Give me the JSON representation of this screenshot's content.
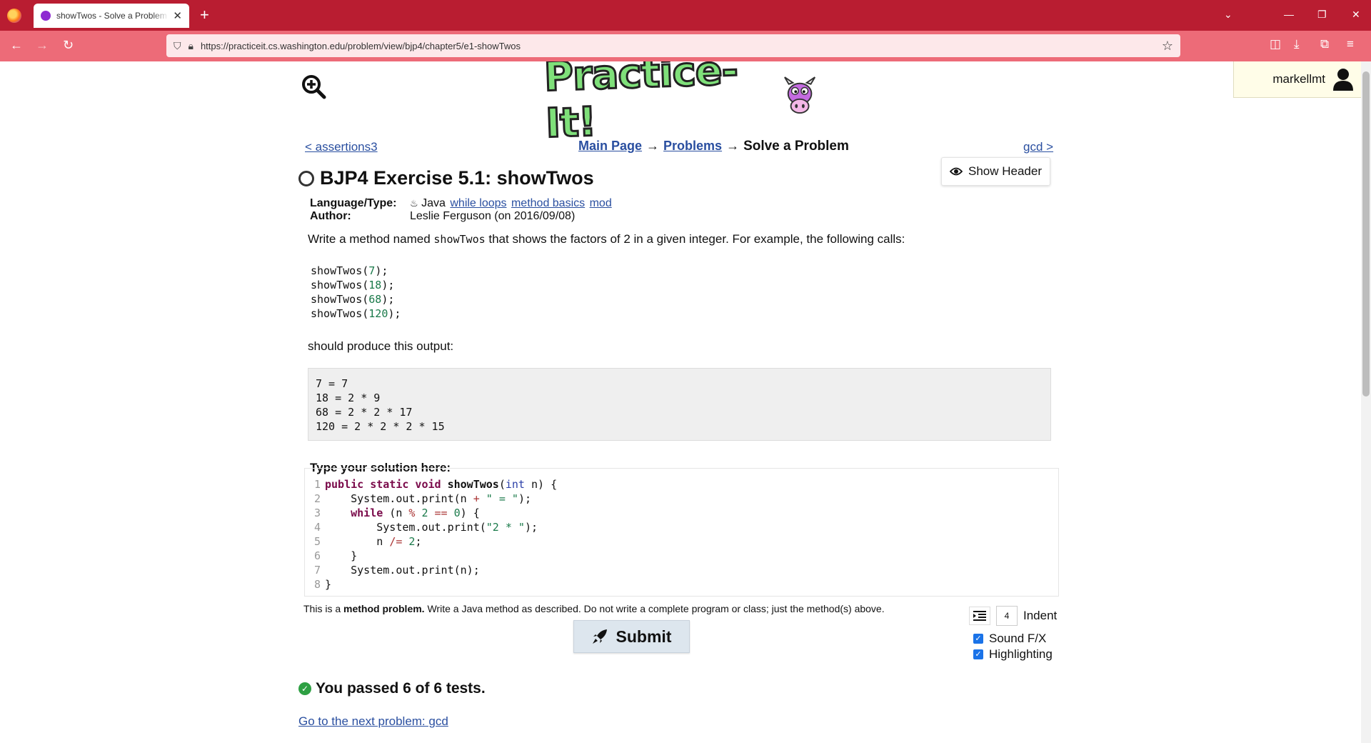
{
  "browser": {
    "tab_title": "showTwos - Solve a Problem - Practice-It",
    "url": "https://practiceit.cs.washington.edu/problem/view/bjp4/chapter5/e1-showTwos"
  },
  "page": {
    "logo_text": "Practice-It!",
    "username": "markellmt",
    "prev_link": "< assertions3",
    "next_link": "gcd >",
    "breadcrumb": {
      "main_page": "Main Page",
      "arrow": "→",
      "problems": "Problems",
      "current": "Solve a Problem"
    },
    "show_header_label": "Show Header",
    "title": "BJP4 Exercise 5.1: showTwos",
    "meta": {
      "language_key": "Language/Type:",
      "language_value": "Java",
      "tags": [
        "while loops",
        "method basics",
        "mod"
      ],
      "author_key": "Author:",
      "author_value": "Leslie Ferguson (on 2016/09/08)"
    },
    "description": {
      "before": "Write a method named ",
      "code": "showTwos",
      "after": " that shows the factors of 2 in a given integer. For example, the following calls:"
    },
    "calls": [
      {
        "fn": "showTwos(",
        "arg": "7",
        "end": ");"
      },
      {
        "fn": "showTwos(",
        "arg": "18",
        "end": ");"
      },
      {
        "fn": "showTwos(",
        "arg": "68",
        "end": ");"
      },
      {
        "fn": "showTwos(",
        "arg": "120",
        "end": ");"
      }
    ],
    "should_produce": "should produce this output:",
    "output_lines": [
      "7 = 7",
      "18 = 2 * 9",
      "68 = 2 * 2 * 17",
      "120 = 2 * 2 * 2 * 15"
    ],
    "solution_label": "Type your solution here:",
    "note": {
      "prefix": "This is a ",
      "bold": "method problem.",
      "suffix": " Write a Java method as described. Do not write a complete program or class; just the method(s) above."
    },
    "indent_value": "4",
    "indent_label": "Indent",
    "submit_label": "Submit",
    "sound_fx_label": "Sound F/X",
    "highlighting_label": "Highlighting",
    "passed_text": "You passed 6 of 6 tests.",
    "next_problem_link": "Go to the next problem: gcd"
  },
  "colors": {
    "tabbar": "#b91d31",
    "navbar": "#ed6b78",
    "link": "#2a4fa0",
    "pass": "#2ea043"
  },
  "icons": [
    "firefox-icon",
    "zoom-in-icon",
    "eye-icon",
    "user-icon",
    "rocket-icon",
    "indent-icon",
    "check-circle-icon"
  ]
}
